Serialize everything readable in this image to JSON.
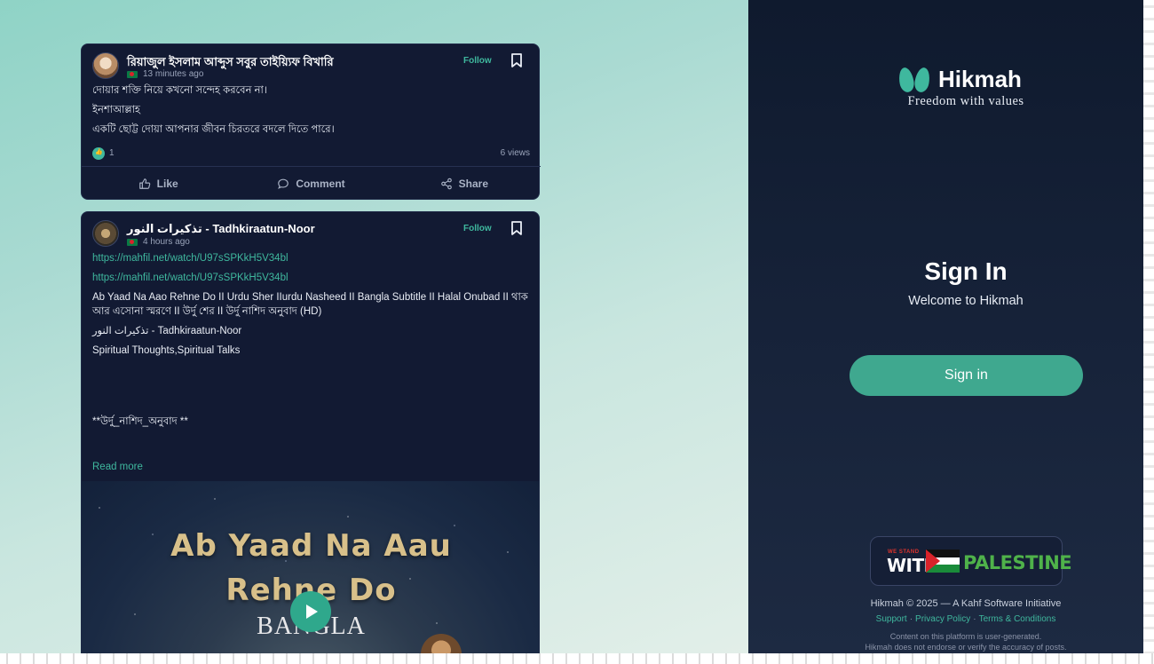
{
  "posts": [
    {
      "author": "রিয়াজুল ইসলাম আব্দুস সবুর তাইয়্যিফ বিখারি",
      "time": "13 minutes ago",
      "follow": "Follow",
      "lines": [
        "দোয়ার শক্তি নিয়ে কখনো সন্দেহ করবেন না।",
        "ইনশাআল্লাহ",
        "একটি ছোট্ট দোয়া আপনার জীবন চিরতরে বদলে দিতে পারে।"
      ],
      "reactions": "1",
      "views": "6 views",
      "actions": {
        "like": "Like",
        "comment": "Comment",
        "share": "Share"
      }
    },
    {
      "author": "تذكيرات النور - Tadhkiraatun-Noor",
      "time": "4 hours ago",
      "follow": "Follow",
      "links": [
        "https://mahfil.net/watch/U97sSPKkH5V34bl",
        "https://mahfil.net/watch/U97sSPKkH5V34bl"
      ],
      "text1": "Ab Yaad Na Aao Rehne Do II Urdu Sher IIurdu Nasheed II Bangla Subtitle II Halal Onubad II থাক আর এসোনা স্মরণে II উর্দু শের II উর্দু নাশিদ অনুবাদ (HD)",
      "text2": "تذكيرات النور - Tadhkiraatun-Noor",
      "text3": "Spiritual Thoughts,Spiritual Talks",
      "text4": "**উর্দু_নাশিদ_অনুবাদ **",
      "read_more": "Read more",
      "thumbnail": {
        "title_line1": "Ab Yaad Na Aau",
        "title_line2": "Rehne Do",
        "subtitle": "BANGLA"
      }
    }
  ],
  "sidebar": {
    "brand": "Hikmah",
    "tagline": "Freedom with values",
    "signin_title": "Sign In",
    "welcome": "Welcome to Hikmah",
    "signin_button": "Sign in",
    "badge": {
      "we_stand": "WE STAND",
      "with": "WITH",
      "palestine": "PALESTINE"
    },
    "copyright": "Hikmah © 2025 — A Kahf Software Initiative",
    "links": [
      "Support",
      "Privacy Policy",
      "Terms & Conditions"
    ],
    "disclaimer_1": "Content on this platform is user-generated.",
    "disclaimer_2": "Hikmah does not endorse or verify the accuracy of posts."
  },
  "colors": {
    "accent": "#3fb89e",
    "panel": "#0f1a2e",
    "card": "#121a33"
  },
  "icons": [
    "bookmark-icon",
    "thumbs-up-icon",
    "comment-icon",
    "share-icon",
    "play-icon",
    "hikmah-logo-icon"
  ]
}
